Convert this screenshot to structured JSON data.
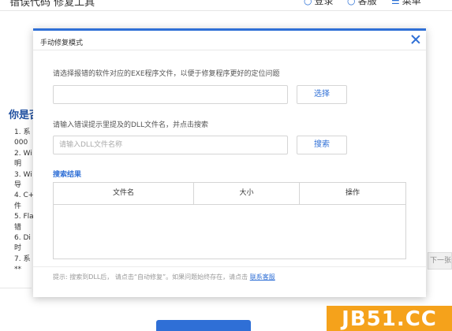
{
  "app": {
    "title": "错误代码 修复工具",
    "login_label": "登录",
    "service_label": "客服",
    "menu_label": "菜单"
  },
  "background": {
    "question": "你是否",
    "list": [
      "1. 系",
      "000",
      "2. Wi",
      "明",
      "3. Wi",
      "导",
      "4. C+",
      "件",
      "5. Fla",
      "错",
      "6. Di",
      "时",
      "7. 系",
      "**"
    ],
    "next_page": "下一张"
  },
  "dialog": {
    "title": "手动修复模式",
    "prompt_exe": "请选择报错的软件对应的EXE程序文件，以便于修复程序更好的定位问题",
    "exe_value": "",
    "select_button": "选择",
    "prompt_dll": "请输入错误提示里提及的DLL文件名，并点击搜索",
    "dll_placeholder": "请输入DLL文件名称",
    "search_button": "搜索",
    "results_title": "搜索结果",
    "table": {
      "headers": [
        "文件名",
        "大小",
        "操作"
      ],
      "rows": []
    },
    "tip_text": "提示:  搜索到DLL后，  请点击“自动修复”。如果问题始终存在，请点击",
    "tip_link": "联系客服"
  },
  "watermark": {
    "text": "JB51.CC"
  },
  "colors": {
    "accent": "#2f6fd6",
    "watermark_bg": "#f5a21b"
  }
}
